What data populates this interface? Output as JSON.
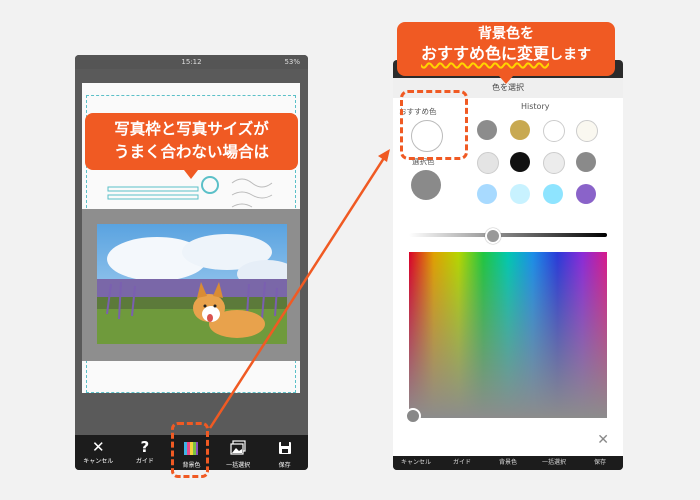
{
  "phone1": {
    "status": {
      "time": "15:12",
      "battery": "53%"
    },
    "callout": {
      "line1": "写真枠と写真サイズが",
      "line2": "うまく合わない場合は"
    },
    "toolbar": [
      {
        "label": "キャンセル",
        "icon": "close-icon",
        "glyph": "✕"
      },
      {
        "label": "ガイド",
        "icon": "question-icon",
        "glyph": "?"
      },
      {
        "label": "背景色",
        "icon": "color-palette-icon",
        "glyph": ""
      },
      {
        "label": "一括選択",
        "icon": "image-stack-icon",
        "glyph": ""
      },
      {
        "label": "保存",
        "icon": "save-icon",
        "glyph": ""
      }
    ]
  },
  "callout2": {
    "line1": "背景色を",
    "line2_em": "おすすめ色に変更",
    "line2_rest": "します"
  },
  "color_picker": {
    "title": "色を選択",
    "recommended_label": "おすすめ色",
    "selected_label": "選択色",
    "history_label": "History",
    "recommended_color": "#ffffff",
    "selected_color": "#8a8a8a",
    "history_colors": [
      "#8c8c8c",
      "#c8a951",
      "#ffffff",
      "#faf8f0",
      "#e4e4e4",
      "#111111",
      "#ececec",
      "#8a8a8a",
      "#a8daff",
      "#c8f2ff",
      "#8ee4ff",
      "#8a63c9"
    ],
    "brightness_level": 0.42,
    "close_glyph": "✕"
  },
  "phone2": {
    "bottom_bar": [
      "キャンセル",
      "ガイド",
      "背景色",
      "一括選択",
      "保存"
    ]
  },
  "accent_color": "#f05a23"
}
